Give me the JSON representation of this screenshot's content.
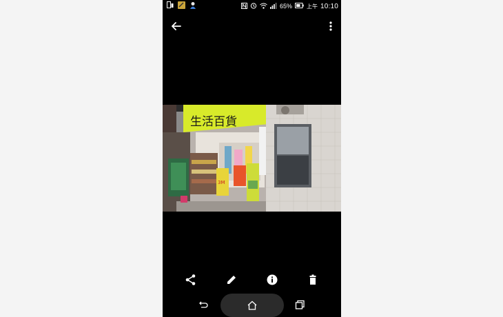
{
  "status_bar": {
    "battery_percent": "65%",
    "ampm": "上午",
    "time": "10:10",
    "icons": [
      "phone-icon",
      "notification-app-icon",
      "avatar-app-icon",
      "nfc-icon",
      "alarm-icon",
      "wifi-icon",
      "signal-icon",
      "battery-icon"
    ]
  },
  "toolbar": {
    "back_icon": "arrow-left-icon",
    "more_icon": "more-vert-icon"
  },
  "photo": {
    "sign_text": "生活百貨",
    "brand_text": "3M"
  },
  "actions": [
    {
      "name": "share",
      "icon": "share-icon"
    },
    {
      "name": "edit",
      "icon": "pencil-icon"
    },
    {
      "name": "info",
      "icon": "info-icon"
    },
    {
      "name": "delete",
      "icon": "trash-icon"
    }
  ],
  "nav": {
    "back_icon": "nav-back-icon",
    "home_icon": "home-icon",
    "recents_icon": "recents-icon"
  },
  "colors": {
    "background": "#f4f4f4",
    "phone": "#000000",
    "sign": "#d8ea2a",
    "icons": "#ffffff"
  }
}
